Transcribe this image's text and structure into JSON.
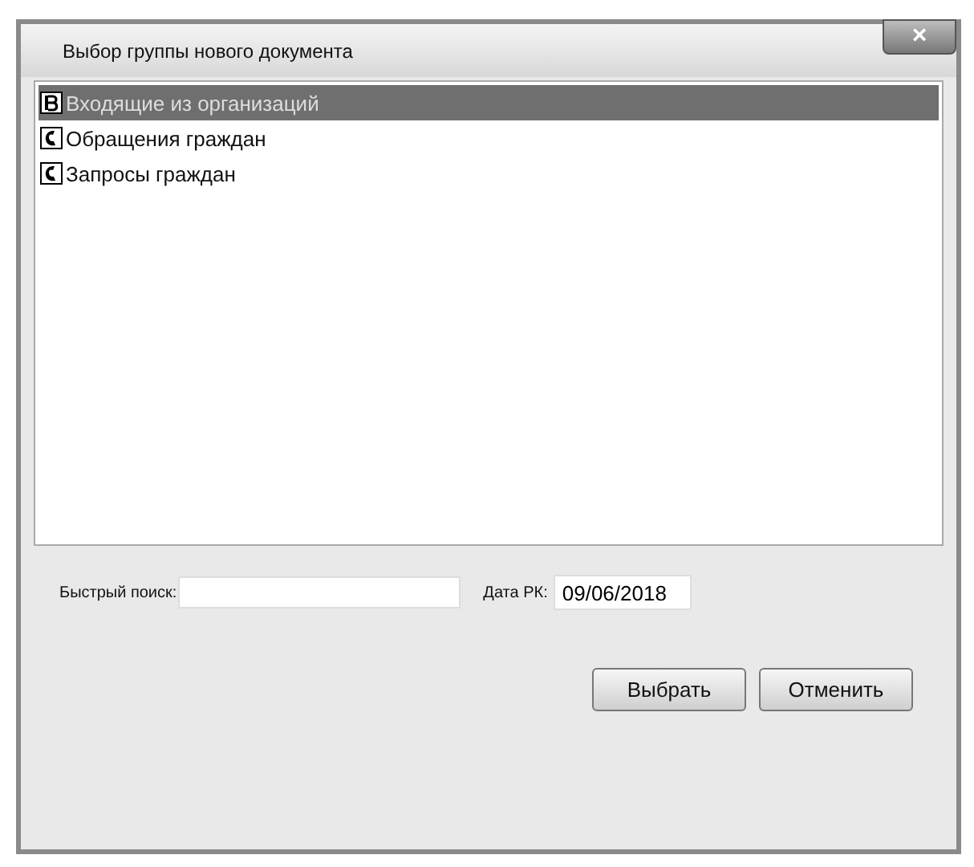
{
  "window": {
    "title": "Выбор группы нового документа",
    "close": "×"
  },
  "list": {
    "items": [
      {
        "label": "Входящие из организаций",
        "kind": "letter",
        "selected": true
      },
      {
        "label": "Обращения граждан",
        "kind": "hand",
        "selected": false
      },
      {
        "label": "Запросы граждан",
        "kind": "hand",
        "selected": false
      }
    ]
  },
  "quick_search": {
    "label": "Быстрый поиск:"
  },
  "date": {
    "label": "Дата РК:",
    "value": "09/06/2018"
  },
  "buttons": [
    "Выбрать",
    "Отменить"
  ]
}
